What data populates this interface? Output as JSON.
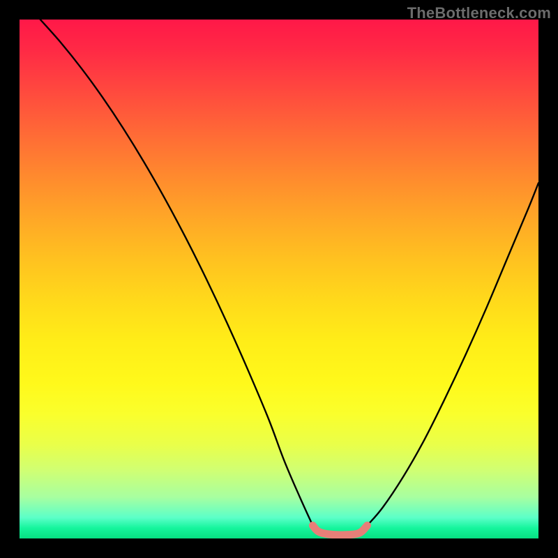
{
  "watermark": "TheBottleneck.com",
  "colors": {
    "curve": "#000000",
    "highlight": "#e77f78",
    "frame": "#000000"
  },
  "chart_data": {
    "type": "line",
    "title": "",
    "xlabel": "",
    "ylabel": "",
    "xlim": [
      0,
      100
    ],
    "ylim": [
      0,
      100
    ],
    "grid": false,
    "legend": false,
    "note": "Values estimated from pixel positions; y=0 at bottom (green), y=100 at top (red). Two black curves descend into a valley; a short coral/pink segment sits at the bottom of the valley.",
    "series": [
      {
        "name": "left-curve",
        "x": [
          4,
          8,
          12,
          16,
          20,
          24,
          28,
          32,
          36,
          40,
          44,
          48,
          51,
          54,
          56.5
        ],
        "y": [
          100,
          95.5,
          90.5,
          85,
          79,
          72.5,
          65.5,
          58,
          50,
          41.5,
          32.5,
          23,
          15,
          8,
          2.5
        ]
      },
      {
        "name": "right-curve",
        "x": [
          67,
          70,
          74,
          78,
          82,
          86,
          90,
          94,
          98,
          100
        ],
        "y": [
          2.5,
          6,
          12,
          19,
          27,
          35.5,
          44.5,
          54,
          63.5,
          68.5
        ]
      },
      {
        "name": "valley-highlight",
        "x": [
          56.5,
          57.5,
          59,
          61,
          63,
          65,
          66,
          67
        ],
        "y": [
          2.5,
          1.4,
          0.9,
          0.7,
          0.7,
          0.9,
          1.4,
          2.5
        ]
      }
    ]
  }
}
